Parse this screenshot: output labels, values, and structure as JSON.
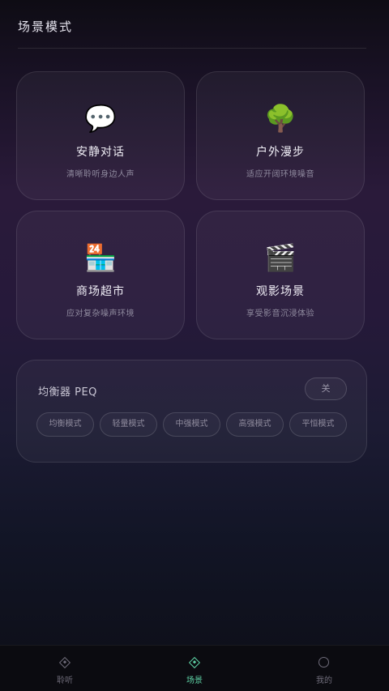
{
  "header": {
    "title": "场景模式"
  },
  "scenes": [
    {
      "icon": "💬",
      "icon_name": "speech-bubble-icon",
      "title": "安静对话",
      "subtitle": "清晰聆听身边人声"
    },
    {
      "icon": "🌳",
      "icon_name": "tree-icon",
      "title": "户外漫步",
      "subtitle": "适应开阔环境噪音"
    },
    {
      "icon": "🏪",
      "icon_name": "convenience-store-icon",
      "title": "商场超市",
      "subtitle": "应对复杂噪声环境"
    },
    {
      "icon": "🎬",
      "icon_name": "clapperboard-icon",
      "title": "观影场景",
      "subtitle": "享受影音沉浸体验"
    }
  ],
  "peq": {
    "title": "均衡器 PEQ",
    "toggle_label": "关",
    "presets": [
      "均衡模式",
      "轻量模式",
      "中强模式",
      "高强模式",
      "平恒模式"
    ]
  },
  "tabbar": {
    "tabs": [
      {
        "label": "聆听",
        "icon_name": "diamond-icon",
        "active": false
      },
      {
        "label": "场景",
        "icon_name": "diamond-icon",
        "active": true
      },
      {
        "label": "我的",
        "icon_name": "circle-icon",
        "active": false
      }
    ]
  },
  "colors": {
    "accent": "#5fd3a6",
    "muted": "#6f6c7a"
  }
}
